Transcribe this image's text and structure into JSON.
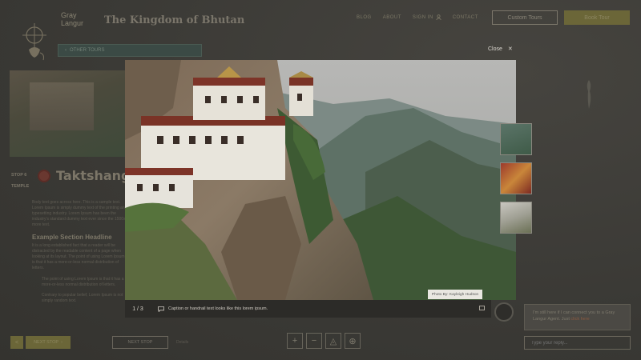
{
  "header": {
    "brand_line1": "Gray",
    "brand_line2": "Langur",
    "site_title": "The Kingdom of Bhutan",
    "nav": [
      "BLOG",
      "ABOUT",
      "SIGN IN",
      "CONTACT"
    ],
    "custom_tours": "Custom Tours",
    "book_tour": "Book Tour"
  },
  "back_bar": {
    "label": "OTHER TOURS"
  },
  "stop": {
    "label_line1": "STOP 6",
    "label_line2": "TEMPLE",
    "heading": "Taktshang",
    "intro": "Body text goes across here. This is a sample text. Lorem Ipsum is simply dummy text of the printing and typesetting industry. Lorem Ipsum has been the industry's standard dummy text ever since the 1500s, more text.",
    "section_headline": "Example Section Headline",
    "section_body": "It is a long established fact that a reader will be distracted by the readable content of a page when looking at its layout. The point of using Lorem Ipsum is that it has a more-or-less normal distribution of letters.",
    "bullet1": "The point of using Lorem Ipsum is that it has a more-or-less normal distribution of letters.",
    "bullet2": "Contrary to popular belief, Lorem Ipsum is not simply random text."
  },
  "gallery": {
    "close_label": "Close",
    "counter": "1 / 3",
    "caption": "Caption or handrail text looks like this lorem ipsum.",
    "credit": "Photo By: Kayleigh Hudson"
  },
  "bottom": {
    "prev_label": "<",
    "next_stop_gold": "NEXT STOP",
    "next_stop_outline": "NEXT STOP",
    "tiny_text": "Details"
  },
  "map_controls": [
    "+",
    "−",
    "◬",
    "⊕"
  ],
  "chat": {
    "message_pre": "I'm still here if I can connect you to a Gray Langur Agent. Just",
    "message_link": "click here",
    "input_placeholder": "Type your reply..."
  }
}
